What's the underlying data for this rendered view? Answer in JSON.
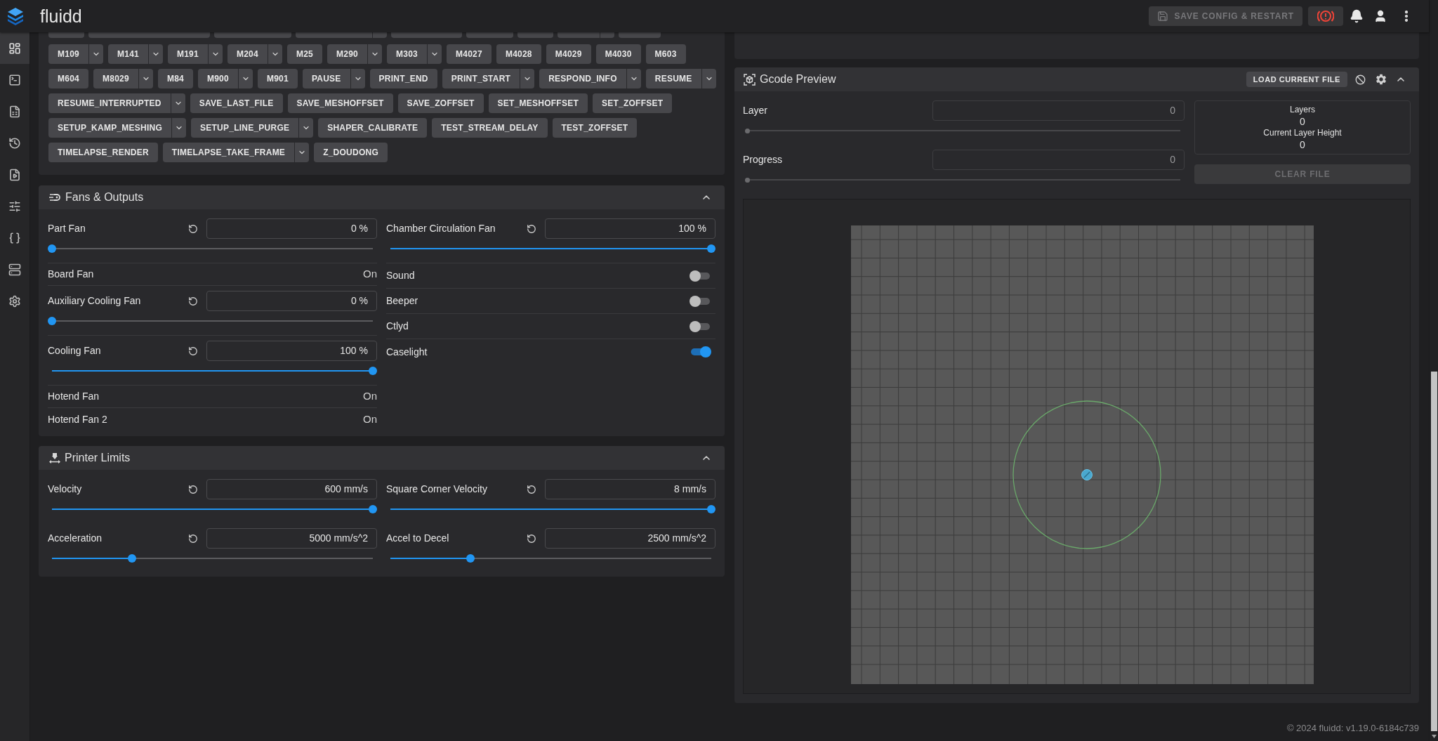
{
  "app_bar": {
    "title": "fluidd",
    "save_button": {
      "label": "SAVE CONFIG & RESTART",
      "disabled": true
    }
  },
  "sidebar": {
    "items": [
      {
        "kind": "dashboard",
        "selected": true
      },
      {
        "kind": "console",
        "selected": false
      },
      {
        "kind": "jobs",
        "selected": false
      },
      {
        "kind": "history",
        "selected": false
      },
      {
        "kind": "timelapse",
        "selected": false
      },
      {
        "kind": "tune",
        "selected": false
      },
      {
        "kind": "config",
        "selected": false
      },
      {
        "kind": "system",
        "selected": false
      },
      {
        "kind": "settings",
        "selected": false
      }
    ]
  },
  "macros": {
    "cut_off_row": [
      {
        "has_menu": false
      },
      {
        "has_menu": false
      },
      {
        "has_menu": false
      },
      {
        "has_menu": true
      },
      {
        "has_menu": false
      },
      {
        "has_menu": false
      },
      {
        "has_menu": false
      },
      {
        "has_menu": true
      },
      {
        "has_menu": false
      }
    ],
    "button_rows": [
      {
        "buttons": [
          {
            "label": "M109",
            "has_menu": true
          },
          {
            "label": "M141",
            "has_menu": true
          },
          {
            "label": "M191",
            "has_menu": true
          },
          {
            "label": "M204",
            "has_menu": true
          },
          {
            "label": "M25",
            "has_menu": false
          },
          {
            "label": "M290",
            "has_menu": true
          },
          {
            "label": "M303",
            "has_menu": true
          },
          {
            "label": "M4027",
            "has_menu": false
          },
          {
            "label": "M4028",
            "has_menu": false
          },
          {
            "label": "M4029",
            "has_menu": false
          },
          {
            "label": "M4030",
            "has_menu": false
          },
          {
            "label": "M603",
            "has_menu": false
          }
        ]
      },
      {
        "buttons": [
          {
            "label": "M604",
            "has_menu": false
          },
          {
            "label": "M8029",
            "has_menu": true
          },
          {
            "label": "M84",
            "has_menu": false
          },
          {
            "label": "M900",
            "has_menu": true
          },
          {
            "label": "M901",
            "has_menu": false
          },
          {
            "label": "PAUSE",
            "has_menu": true
          },
          {
            "label": "PRINT_END",
            "has_menu": false
          },
          {
            "label": "PRINT_START",
            "has_menu": true
          },
          {
            "label": "RESPOND_INFO",
            "has_menu": true
          },
          {
            "label": "RESUME",
            "has_menu": true
          }
        ]
      },
      {
        "buttons": [
          {
            "label": "RESUME_INTERRUPTED",
            "has_menu": true
          },
          {
            "label": "SAVE_LAST_FILE",
            "has_menu": false
          },
          {
            "label": "SAVE_MESHOFFSET",
            "has_menu": false
          },
          {
            "label": "SAVE_ZOFFSET",
            "has_menu": false
          },
          {
            "label": "SET_MESHOFFSET",
            "has_menu": false
          },
          {
            "label": "SET_ZOFFSET",
            "has_menu": false
          }
        ]
      },
      {
        "buttons": [
          {
            "label": "SETUP_KAMP_MESHING",
            "has_menu": true
          },
          {
            "label": "SETUP_LINE_PURGE",
            "has_menu": true
          },
          {
            "label": "SHAPER_CALIBRATE",
            "has_menu": false
          },
          {
            "label": "TEST_STREAM_DELAY",
            "has_menu": false
          },
          {
            "label": "TEST_ZOFFSET",
            "has_menu": false
          }
        ]
      },
      {
        "buttons": [
          {
            "label": "TIMELAPSE_RENDER",
            "has_menu": false
          },
          {
            "label": "TIMELAPSE_TAKE_FRAME",
            "has_menu": true
          },
          {
            "label": "Z_DOUDONG",
            "has_menu": false
          }
        ]
      }
    ]
  },
  "fans_outputs": {
    "title": "Fans & Outputs",
    "expanded": true,
    "left": [
      {
        "kind": "slider",
        "label": "Part Fan",
        "value": "0 %",
        "level": 0
      },
      {
        "kind": "status",
        "label": "Board Fan",
        "value": "On"
      },
      {
        "kind": "slider",
        "label": "Auxiliary Cooling Fan",
        "value": "0 %",
        "level": 0
      },
      {
        "kind": "slider",
        "label": "Cooling Fan",
        "value": "100 %",
        "level": 1
      },
      {
        "kind": "status",
        "label": "Hotend Fan",
        "value": "On"
      },
      {
        "kind": "status",
        "label": "Hotend Fan 2",
        "value": "On"
      }
    ],
    "right": [
      {
        "kind": "slider",
        "label": "Chamber Circulation Fan",
        "value": "100 %",
        "level": 1
      },
      {
        "kind": "toggle",
        "label": "Sound",
        "on": false
      },
      {
        "kind": "toggle",
        "label": "Beeper",
        "on": false
      },
      {
        "kind": "toggle",
        "label": "Ctlyd",
        "on": false
      },
      {
        "kind": "toggle",
        "label": "Caselight",
        "on": true
      }
    ]
  },
  "printer_limits": {
    "title": "Printer Limits",
    "expanded": true,
    "items": [
      {
        "label": "Velocity",
        "value": "600 mm/s",
        "level": 1
      },
      {
        "label": "Square Corner Velocity",
        "value": "8 mm/s",
        "level": 1
      },
      {
        "label": "Acceleration",
        "value": "5000 mm/s^2",
        "level": 0.25
      },
      {
        "label": "Accel to Decel",
        "value": "2500 mm/s^2",
        "level": 0.25
      }
    ]
  },
  "gcode_preview": {
    "title": "Gcode Preview",
    "expanded": true,
    "load_button": "LOAD CURRENT FILE",
    "controls": [
      {
        "label": "Layer",
        "value": "0",
        "level": 0,
        "disabled": true
      },
      {
        "label": "Progress",
        "value": "0",
        "level": 0,
        "disabled": true
      }
    ],
    "stats": [
      {
        "label": "Layers",
        "value": "0"
      },
      {
        "label": "Current Layer Height",
        "value": "0"
      }
    ],
    "clear_button": {
      "label": "CLEAR FILE",
      "disabled": true
    }
  },
  "footer": "© 2024 fluidd: v1.19.0-6184c739"
}
